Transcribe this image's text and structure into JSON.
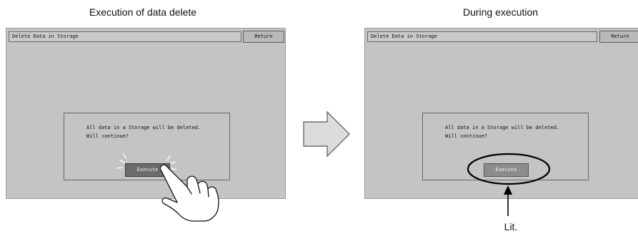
{
  "captions": {
    "left": "Execution of data delete",
    "right": "During execution",
    "lit": "Lit."
  },
  "screen": {
    "title": "Delete Data in Storage",
    "return_label": "Return",
    "dialog": {
      "line1": "All data in a Storage will be deleted.",
      "line2": "Will continue?",
      "execute_label": "Execute"
    }
  },
  "icons": {
    "hand": "pointing-hand-icon",
    "arrow": "right-arrow-icon",
    "pointer": "up-arrow-icon"
  },
  "colors": {
    "screen_bg": "#c4c4c4",
    "execute_pressed": "#6b6b6b",
    "execute_lit": "#8c8c8c"
  }
}
